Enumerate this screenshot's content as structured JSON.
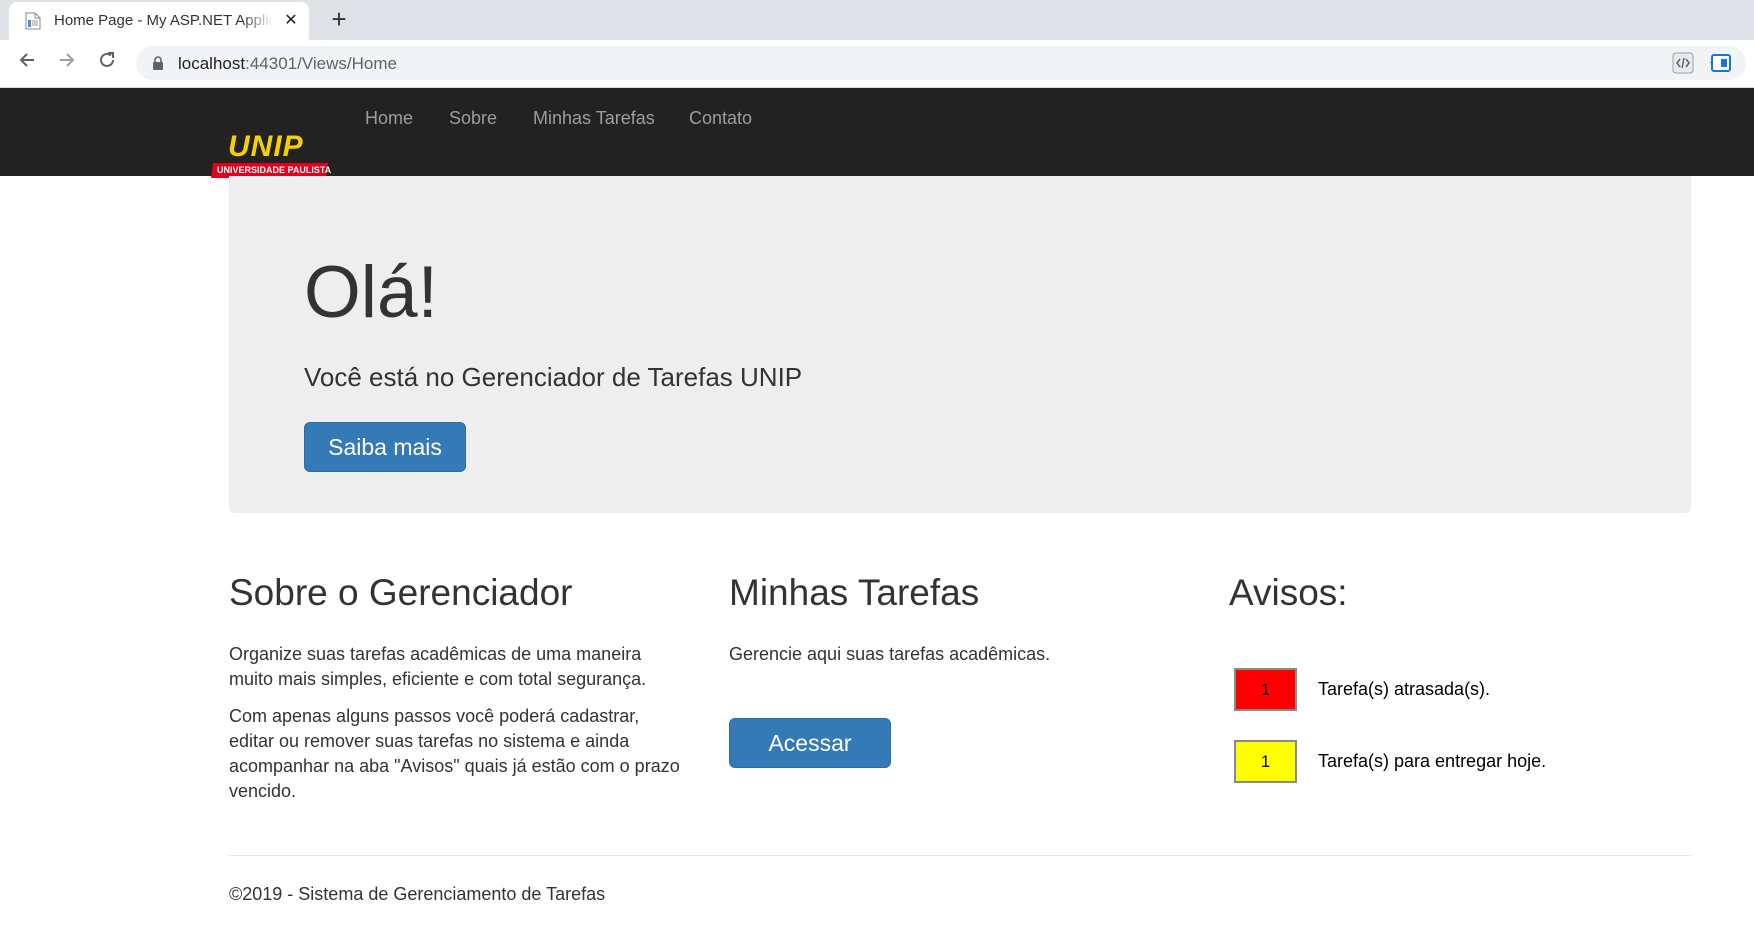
{
  "browser": {
    "tab_title": "Home Page - My ASP.NET Applic",
    "new_tab_icon": "+",
    "url_host": "localhost",
    "url_rest": ":44301/Views/Home"
  },
  "navbar": {
    "logo_text": "UNIP",
    "logo_subtitle": "UNIVERSIDADE PAULISTA",
    "links": [
      "Home",
      "Sobre",
      "Minhas Tarefas",
      "Contato"
    ]
  },
  "jumbotron": {
    "heading": "Olá!",
    "lead": "Você está no Gerenciador de Tarefas UNIP",
    "button": "Saiba mais"
  },
  "columns": {
    "sobre": {
      "title": "Sobre o Gerenciador",
      "paragraph1": "Organize suas tarefas acadêmicas de uma maneira muito mais simples, eficiente e com total segurança.",
      "paragraph2": "Com apenas alguns passos você poderá cadastrar, editar ou remover suas tarefas no sistema e ainda acompanhar na aba \"Avisos\" quais já estão com o prazo vencido."
    },
    "tarefas": {
      "title": "Minhas Tarefas",
      "text": "Gerencie aqui suas tarefas acadêmicas.",
      "button": "Acessar"
    },
    "avisos": {
      "title": "Avisos:",
      "items": [
        {
          "count": "1",
          "label": "Tarefa(s) atrasada(s).",
          "color": "#ff0000"
        },
        {
          "count": "1",
          "label": "Tarefa(s) para entregar hoje.",
          "color": "#ffff00"
        }
      ]
    }
  },
  "footer": {
    "text": "©2019 - Sistema de Gerenciamento de Tarefas"
  },
  "colors": {
    "navbar_bg": "#222222",
    "primary": "#337ab7",
    "jumbotron_bg": "#eeeeee",
    "logo_yellow": "#f5d000",
    "logo_red": "#e2001a"
  }
}
